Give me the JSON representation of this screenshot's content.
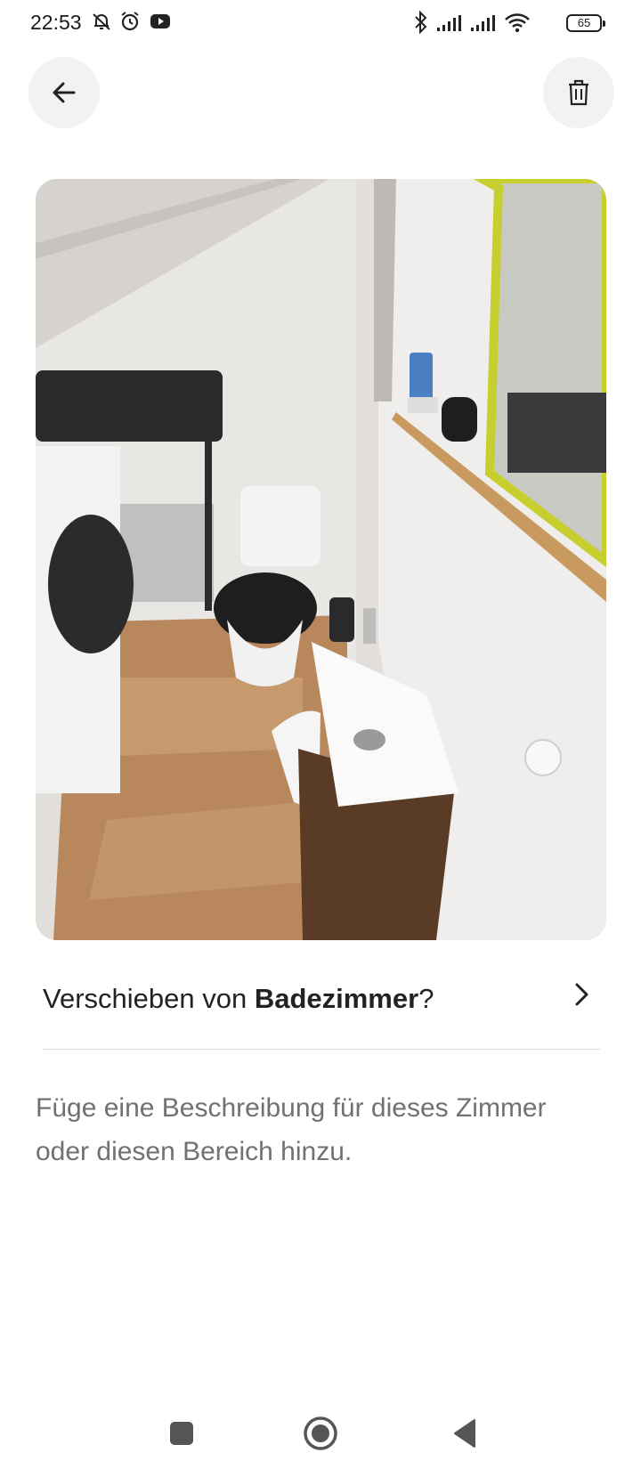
{
  "status_bar": {
    "time": "22:53",
    "left_icons": [
      "bell-off-icon",
      "alarm-icon",
      "youtube-icon"
    ],
    "right_icons": [
      "bluetooth-icon",
      "signal-icon",
      "signal-icon",
      "wifi-icon"
    ],
    "battery": "65"
  },
  "header": {
    "back_icon": "arrow-left-icon",
    "delete_icon": "trash-icon"
  },
  "photo": {
    "subject": "bathroom-photo"
  },
  "move_row": {
    "prefix": "Verschieben von ",
    "room": "Badezimmer",
    "suffix": "?"
  },
  "description": {
    "text": "Füge eine Beschreibung für dieses Zimmer oder diesen Bereich hinzu."
  },
  "nav_bar": {
    "icons": [
      "recents-icon",
      "home-icon",
      "back-icon"
    ]
  }
}
